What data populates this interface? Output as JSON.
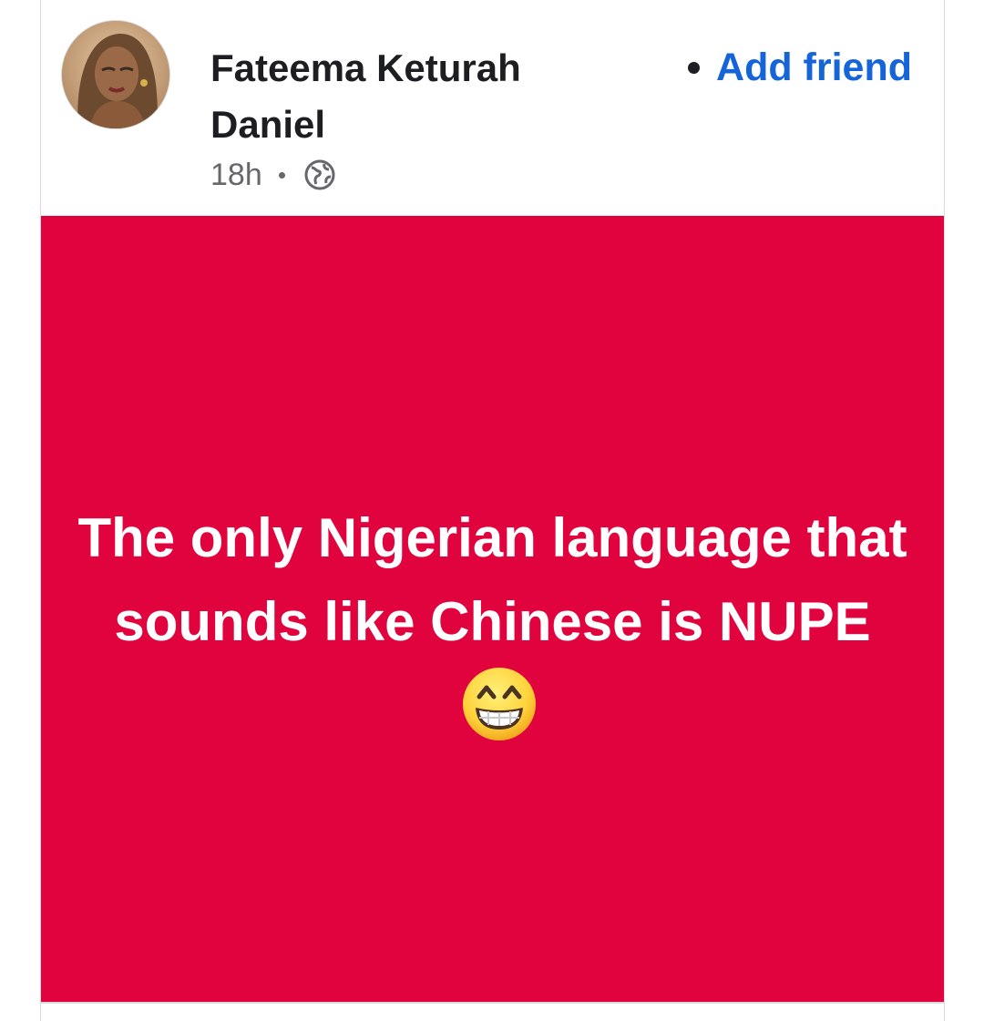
{
  "post": {
    "author_name": "Fateema Keturah Daniel",
    "time": "18h",
    "audience_icon": "globe-icon",
    "add_friend_label": "Add friend",
    "body_text": "The only Nigerian language that sounds like Chinese is NUPE",
    "emoji": "grinning-face-icon",
    "background_color": "#e0033e",
    "link_color": "#1565d8"
  }
}
